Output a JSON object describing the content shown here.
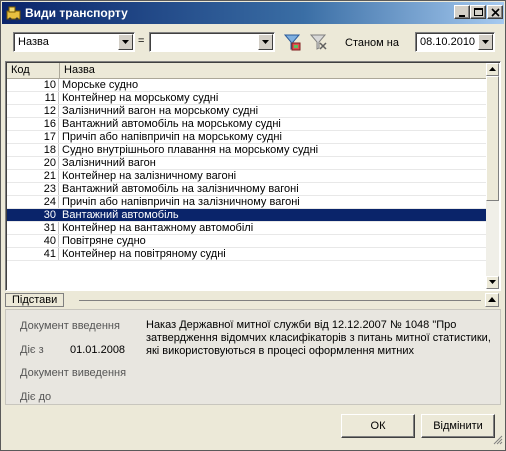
{
  "window": {
    "title": "Види транспорту"
  },
  "toolbar": {
    "field_value": "Назва",
    "equals": "=",
    "filter_value": "",
    "as_of_label": "Станом на",
    "date_value": "08.10.2010"
  },
  "grid": {
    "columns": [
      "Код",
      "Назва"
    ],
    "rows": [
      {
        "code": "10",
        "name": "Морське судно"
      },
      {
        "code": "11",
        "name": "Контейнер на морському судні"
      },
      {
        "code": "12",
        "name": "Залізничний вагон на морському судні"
      },
      {
        "code": "16",
        "name": "Вантажний автомобіль на морському судні"
      },
      {
        "code": "17",
        "name": "Причіп або напівпричіп на морському судні"
      },
      {
        "code": "18",
        "name": "Судно внутрішнього плавання на морському судні"
      },
      {
        "code": "20",
        "name": "Залізничний вагон"
      },
      {
        "code": "21",
        "name": "Контейнер на залізничному вагоні"
      },
      {
        "code": "23",
        "name": "Вантажний автомобіль на залізничному вагоні"
      },
      {
        "code": "24",
        "name": "Причіп або напівпричіп на залізничному вагоні"
      },
      {
        "code": "30",
        "name": "Вантажний автомобіль"
      },
      {
        "code": "31",
        "name": "Контейнер на вантажному автомобілі"
      },
      {
        "code": "40",
        "name": "Повітряне судно"
      },
      {
        "code": "41",
        "name": "Контейнер на повітряному судні"
      }
    ],
    "selected_code": "30"
  },
  "details": {
    "section_title": "Підстави",
    "doc_intro_label": "Документ введення",
    "date_from_label": "Діє з",
    "date_from_value": "01.01.2008",
    "doc_outro_label": "Документ виведення",
    "date_to_label": "Діє до",
    "doc_text": "Наказ Державної митної служби від 12.12.2007 № 1048 \"Про затвердження відомчих класифікаторів з питань митної статистики, які використовуються в процесі оформлення митних"
  },
  "buttons": {
    "ok": "ОК",
    "cancel": "Відмінити"
  },
  "colors": {
    "selection": "#0a246a",
    "titlebar": "#0a246a"
  }
}
